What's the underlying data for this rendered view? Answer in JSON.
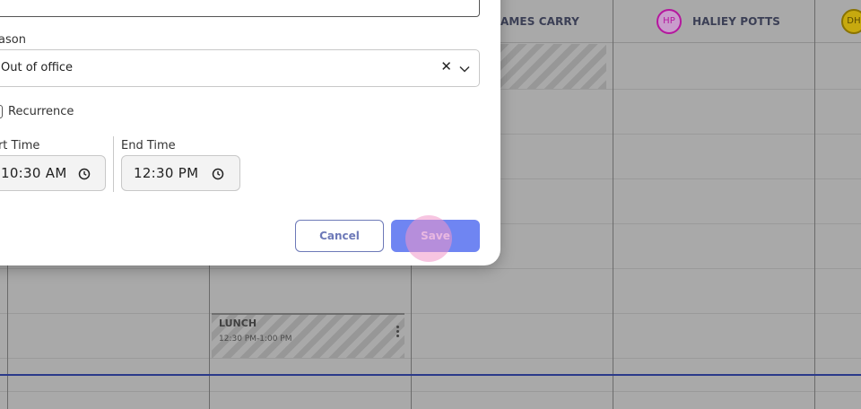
{
  "calendar": {
    "columns": [
      {
        "name": "AMES CARRY"
      },
      {
        "name": "HALIEY POTTS",
        "initials": "HP",
        "avatar_color": "#b5179e"
      },
      {
        "name": "",
        "initials": "DH",
        "avatar_color": "#d4b106"
      }
    ],
    "event": {
      "title": "LUNCH",
      "time": "12:30 PM-1:00 PM"
    }
  },
  "modal": {
    "reason_label": "eason",
    "reason_value": "Out of office",
    "clear_glyph": "✕",
    "recurrence_label": "Recurrence",
    "start_time_label": "art Time",
    "start_time_value": "10:30  AM",
    "end_time_label": "End Time",
    "end_time_value": "12:30  PM",
    "cancel_label": "Cancel",
    "save_label": "Save"
  },
  "colors": {
    "primary": "#6f85f2",
    "cancel_border": "#6d79b8",
    "overlay": "#a9a9a9"
  }
}
